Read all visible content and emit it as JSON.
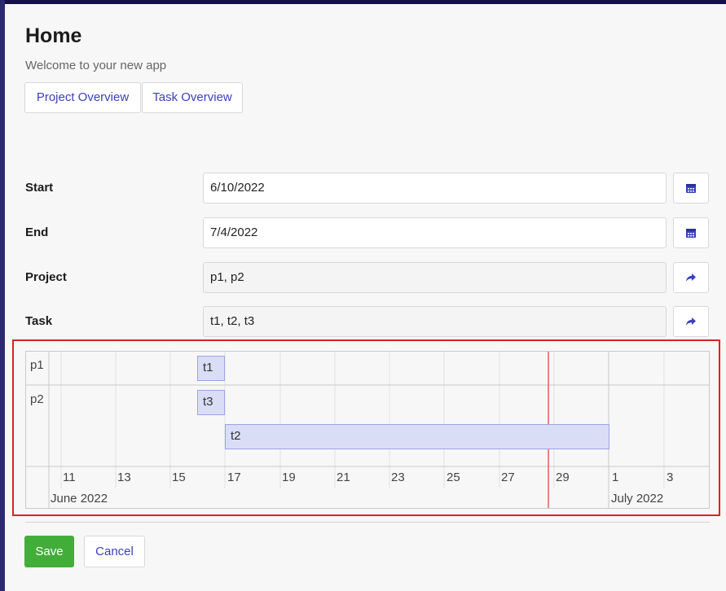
{
  "page": {
    "title": "Home",
    "subtitle": "Welcome to your new app"
  },
  "tabs": [
    {
      "label": "Project Overview"
    },
    {
      "label": "Task Overview"
    }
  ],
  "form": {
    "start": {
      "label": "Start",
      "value": "6/10/2022",
      "icon": "calendar-icon"
    },
    "end": {
      "label": "End",
      "value": "7/4/2022",
      "icon": "calendar-icon"
    },
    "project": {
      "label": "Project",
      "value": "p1, p2",
      "icon": "share-arrow-icon"
    },
    "task": {
      "label": "Task",
      "value": "t1, t2, t3",
      "icon": "share-arrow-icon"
    }
  },
  "gantt": {
    "rows": [
      {
        "label": "p1"
      },
      {
        "label": "p2"
      }
    ],
    "tasks": [
      {
        "label": "t1",
        "project": "p1",
        "start": "2022-06-16",
        "end": "2022-06-17"
      },
      {
        "label": "t3",
        "project": "p2",
        "start": "2022-06-16",
        "end": "2022-06-17"
      },
      {
        "label": "t2",
        "project": "p2",
        "start": "2022-06-17",
        "end": "2022-06-30"
      }
    ],
    "ticks": [
      "11",
      "13",
      "15",
      "17",
      "19",
      "21",
      "23",
      "25",
      "27",
      "29",
      "1",
      "3"
    ],
    "months": [
      "June 2022",
      "July 2022"
    ],
    "today_marker": "2022-06-29",
    "colors": {
      "bar_fill": "#d9ddf6",
      "bar_border": "#9aa4e8",
      "today_line": "#f08080"
    }
  },
  "actions": {
    "save": "Save",
    "cancel": "Cancel"
  },
  "colors": {
    "accent": "#3a3fc0",
    "save_button": "#43ad3a",
    "highlight_border": "#e02020"
  }
}
